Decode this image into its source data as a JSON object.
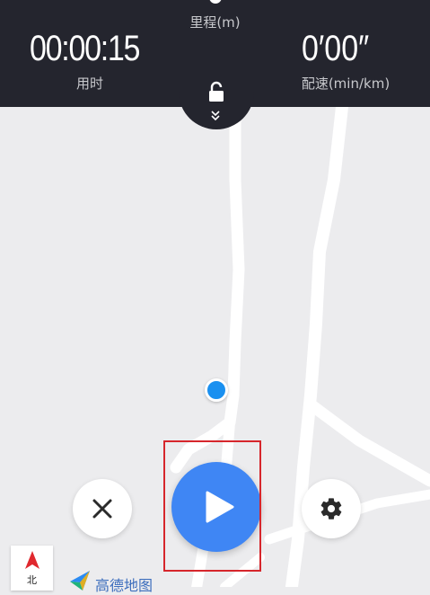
{
  "stats": {
    "distance_label": "里程(m)",
    "time_value": "00:00:15",
    "time_label": "用时",
    "pace_value": "0′00″",
    "pace_label": "配速(min/km)"
  },
  "controls": {
    "stop_icon": "close-icon",
    "play_icon": "play-icon",
    "settings_icon": "gear-icon"
  },
  "compass": {
    "label": "北"
  },
  "map_brand": {
    "text": "高德地图"
  },
  "colors": {
    "panel_bg": "#24252e",
    "play_button": "#3f86f4",
    "location_dot": "#1a90f0",
    "highlight": "#d6262c"
  }
}
